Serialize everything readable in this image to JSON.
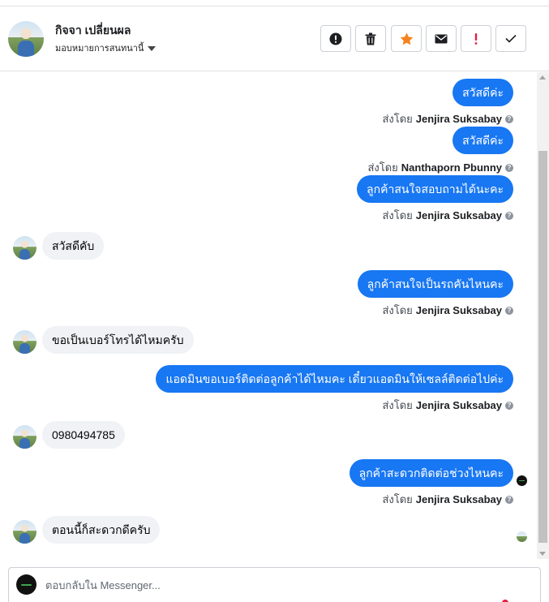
{
  "header": {
    "contact_name": "กิจจา เปลี่ยนผล",
    "assign_label": "มอบหมายการสนทนานี้",
    "actions": [
      {
        "icon": "exclamation-circle-icon",
        "color": "#1c1e21"
      },
      {
        "icon": "trash-icon",
        "color": "#1c1e21"
      },
      {
        "icon": "star-icon",
        "color": "#f5821f"
      },
      {
        "icon": "envelope-icon",
        "color": "#1c1e21"
      },
      {
        "icon": "exclamation-icon",
        "color": "#e41e3f"
      },
      {
        "icon": "check-icon",
        "color": "#1c1e21"
      }
    ]
  },
  "thread": {
    "sent_by_prefix": "ส่งโดย",
    "help_icon": "?",
    "messages": [
      {
        "text": "สวัสดีค่ะ",
        "sender": "Jenjira Suksabay"
      },
      {
        "text": "สวัสดีค่ะ",
        "sender": "Nanthaporn Pbunny"
      },
      {
        "text": "ลูกค้าสนใจสอบถามได้นะคะ",
        "sender": "Jenjira Suksabay"
      },
      {
        "text": "สวัสดีคับ"
      },
      {
        "text": "ลูกค้าสนใจเป็นรถคันไหนคะ",
        "sender": "Jenjira Suksabay"
      },
      {
        "text": "ขอเป็นเบอร์โทรได้ไหมครับ"
      },
      {
        "text": "แอดมินขอเบอร์ติดต่อลูกค้าได้ไหมคะ เดี๋ยวแอดมินให้เซลล์ติดต่อไปค่ะ",
        "sender": "Jenjira Suksabay"
      },
      {
        "text": "0980494785"
      },
      {
        "text": "ลูกค้าสะดวกติดต่อช่วงไหนคะ",
        "sender": "Jenjira Suksabay"
      },
      {
        "text": "ตอนนี้ก็สะดวกดีครับ"
      }
    ]
  },
  "composer": {
    "placeholder": "ตอบกลับใน Messenger..."
  },
  "colors": {
    "outgoing_bubble": "#1877f2",
    "incoming_bubble": "#f0f2f5",
    "star": "#f5821f",
    "alert": "#e41e3f"
  }
}
